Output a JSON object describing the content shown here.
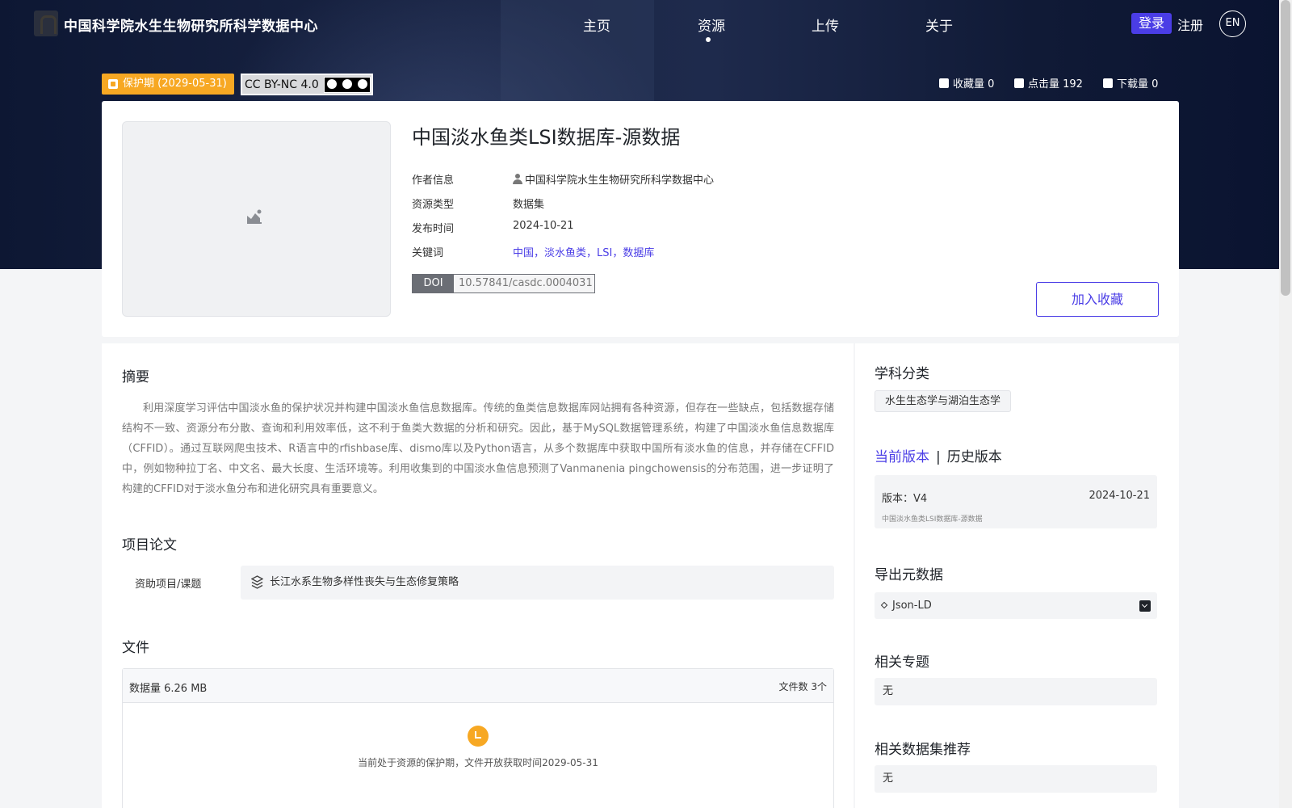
{
  "site": {
    "title": "中国科学院水生生物研究所科学数据中心"
  },
  "nav": {
    "items": [
      "主页",
      "资源",
      "上传",
      "关于"
    ],
    "active_index": 1,
    "login": "登录",
    "register": "注册",
    "language": "EN"
  },
  "badges": {
    "protection": "保护期 (2029-05-31)",
    "license": "CC BY-NC 4.0"
  },
  "stats": {
    "favorites": "收藏量 0",
    "views": "点击量 192",
    "downloads": "下载量 0"
  },
  "dataset": {
    "title": "中国淡水鱼类LSI数据库-源数据",
    "meta": {
      "author_label": "作者信息",
      "author_value": "中国科学院水生生物研究所科学数据中心",
      "type_label": "资源类型",
      "type_value": "数据集",
      "date_label": "发布时间",
      "date_value": "2024-10-21",
      "keywords_label": "关键词",
      "keywords_value": "中国，淡水鱼类，LSI，数据库"
    },
    "doi_label": "DOI",
    "doi_value": "10.57841/casdc.0004031",
    "favorite_button": "加入收藏"
  },
  "abstract": {
    "title": "摘要",
    "text": "利用深度学习评估中国淡水鱼的保护状况并构建中国淡水鱼信息数据库。传统的鱼类信息数据库网站拥有各种资源，但存在一些缺点，包括数据存储结构不一致、资源分布分散、查询和利用效率低，这不利于鱼类大数据的分析和研究。因此，基于MySQL数据管理系统，构建了中国淡水鱼信息数据库（CFFID）。通过互联网爬虫技术、R语言中的rfishbase库、dismo库以及Python语言，从多个数据库中获取中国所有淡水鱼的信息，并存储在CFFID中，例如物种拉丁名、中文名、最大长度、生活环境等。利用收集到的中国淡水鱼信息预测了Vanmanenia pingchowensis的分布范围，进一步证明了构建的CFFID对于淡水鱼分布和进化研究具有重要意义。"
  },
  "project": {
    "title": "项目论文",
    "fund_label": "资助项目/课题",
    "fund_value": "长江水系生物多样性丧失与生态修复策略"
  },
  "files": {
    "title": "文件",
    "size": "数据量 6.26 MB",
    "count": "文件数 3个",
    "message": "当前处于资源的保护期，文件开放获取时间2029-05-31"
  },
  "sidebar": {
    "subject_title": "学科分类",
    "subject_tag": "水生生态学与湖泊生态学",
    "version_tab_current": "当前版本",
    "version_tab_sep": "|",
    "version_tab_history": "历史版本",
    "version": "版本：V4",
    "version_date": "2024-10-21",
    "version_name": "中国淡水鱼类LSI数据库-源数据",
    "export_title": "导出元数据",
    "export_option": "Json-LD",
    "topics_title": "相关专题",
    "topics_value": "无",
    "related_title": "相关数据集推荐",
    "related_value": "无"
  },
  "colors": {
    "accent": "#4a3de6",
    "warning": "#f7a823",
    "hero": "#141f3d"
  }
}
